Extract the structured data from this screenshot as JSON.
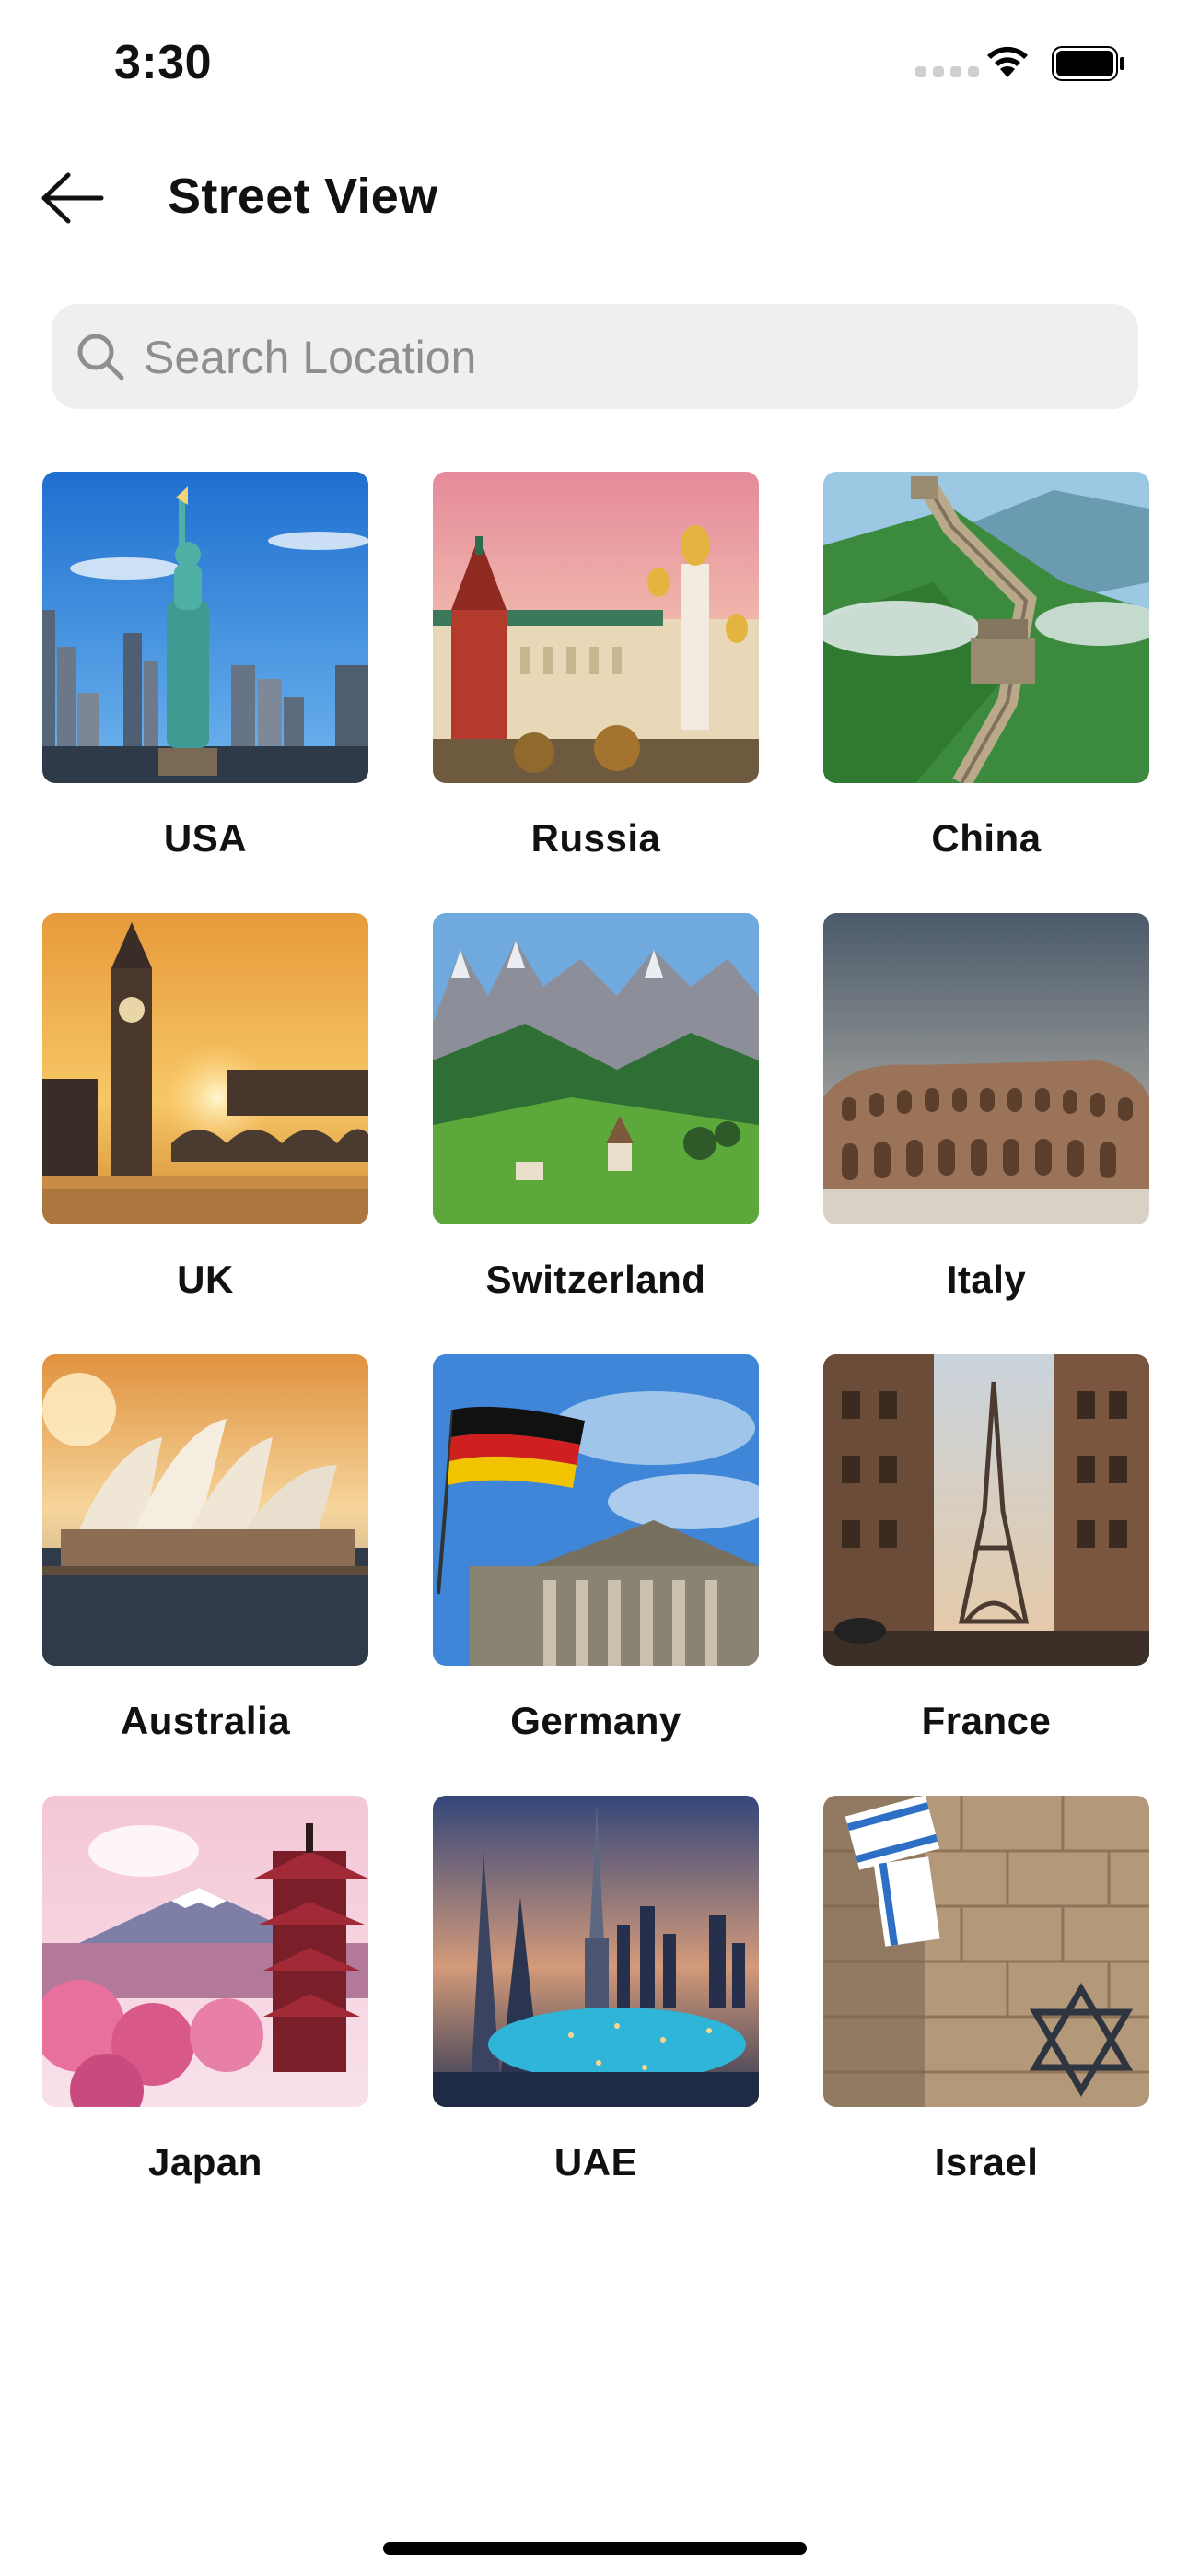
{
  "status_bar": {
    "time": "3:30"
  },
  "header": {
    "title": "Street View"
  },
  "search": {
    "placeholder": "Search Location",
    "value": ""
  },
  "locations": [
    {
      "label": "USA"
    },
    {
      "label": "Russia"
    },
    {
      "label": "China"
    },
    {
      "label": "UK"
    },
    {
      "label": "Switzerland"
    },
    {
      "label": "Italy"
    },
    {
      "label": "Australia"
    },
    {
      "label": "Germany"
    },
    {
      "label": "France"
    },
    {
      "label": "Japan"
    },
    {
      "label": "UAE"
    },
    {
      "label": "Israel"
    }
  ],
  "icons": {
    "back": "arrow-left-icon",
    "search": "search-icon",
    "wifi": "wifi-icon",
    "battery": "battery-icon"
  }
}
